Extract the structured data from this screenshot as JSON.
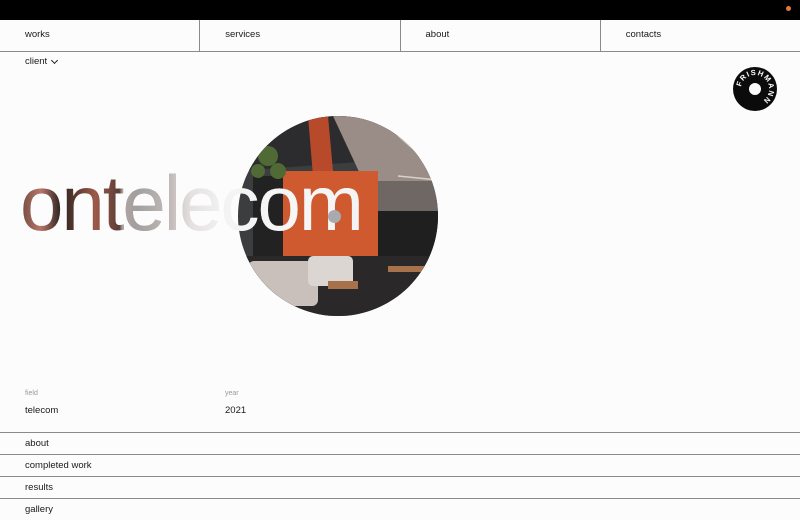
{
  "nav": {
    "items": [
      {
        "label": "works"
      },
      {
        "label": "services"
      },
      {
        "label": "about"
      },
      {
        "label": "contacts"
      }
    ]
  },
  "client_dropdown": {
    "label": "client",
    "icon": "chevron-down-icon"
  },
  "logo": {
    "text": "FRISHMANN"
  },
  "hero": {
    "title": "ontelecom"
  },
  "meta": {
    "field_label": "field",
    "field_value": "telecom",
    "year_label": "year",
    "year_value": "2021"
  },
  "sections": [
    {
      "label": "about"
    },
    {
      "label": "completed work"
    },
    {
      "label": "results"
    },
    {
      "label": "gallery"
    }
  ],
  "colors": {
    "accent": "#e05a2b",
    "text": "#1a1a1a",
    "divider": "#8a8a8a",
    "background": "#fdfcfd"
  }
}
